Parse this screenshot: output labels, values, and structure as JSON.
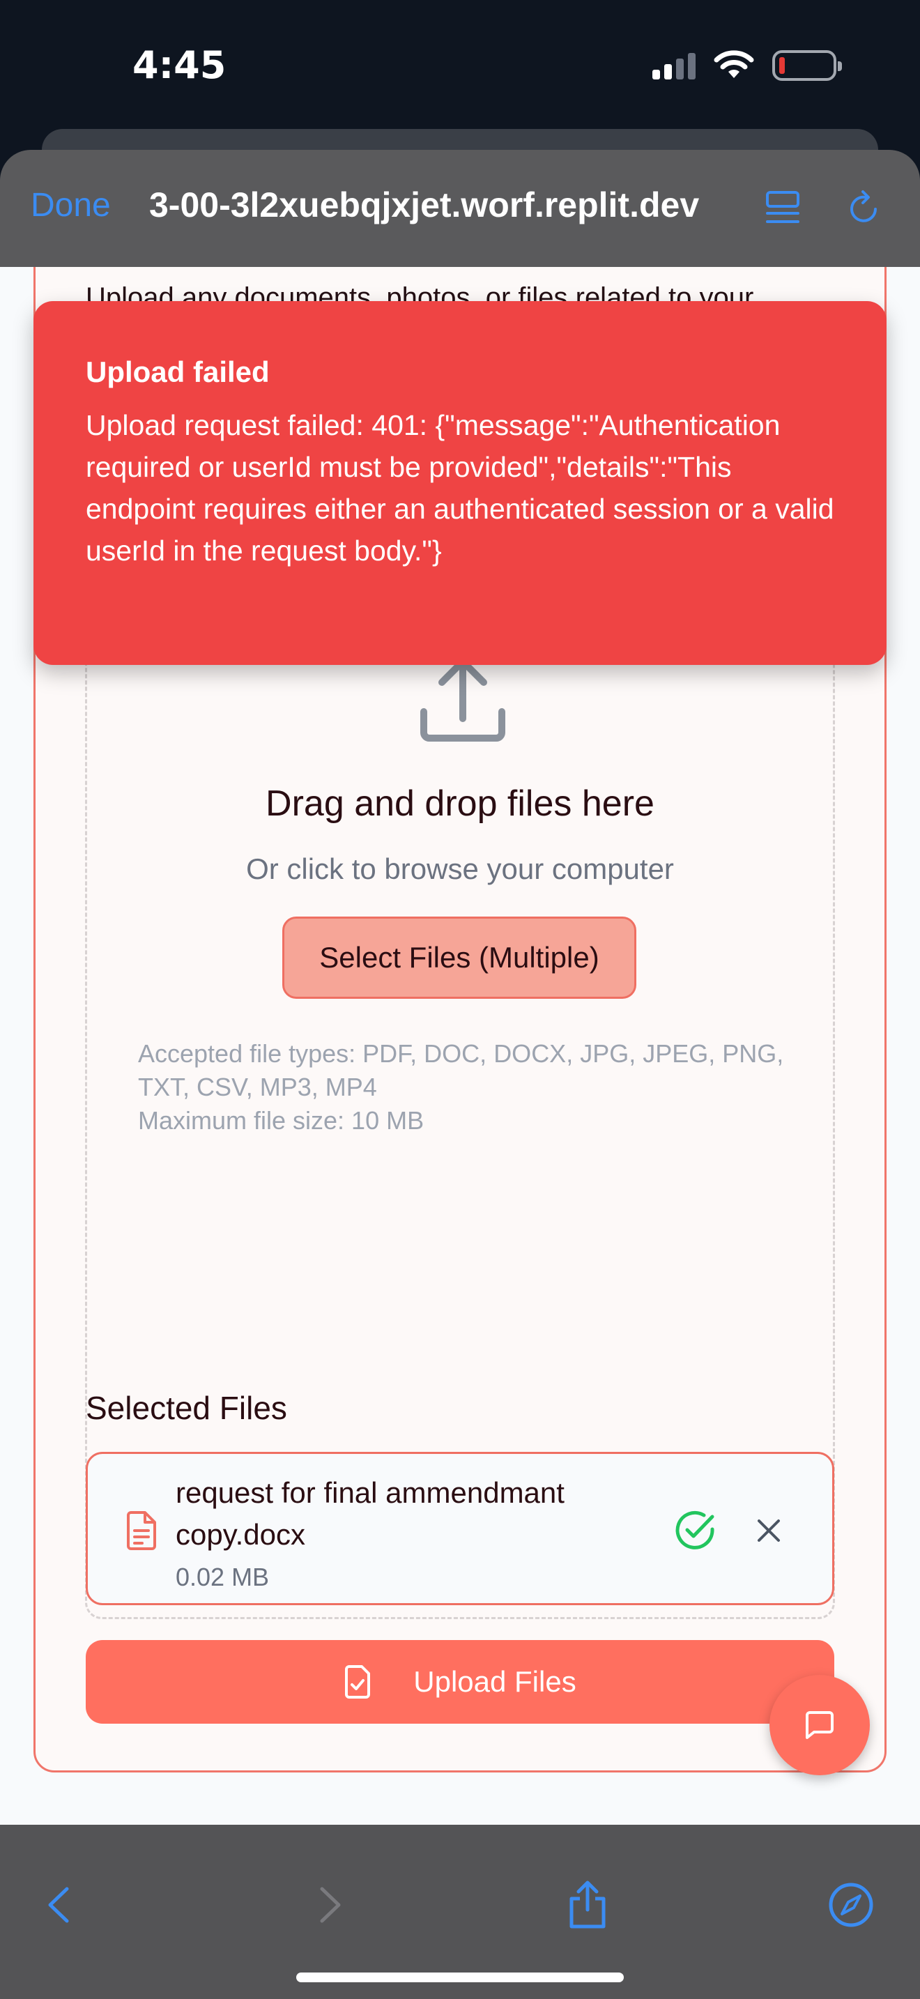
{
  "status_bar": {
    "time": "4:45"
  },
  "browser": {
    "done_label": "Done",
    "url": "3-00-3l2xuebqjxjet.worf.replit.dev"
  },
  "page": {
    "description": "Upload any documents, photos, or files related to your",
    "dropzone": {
      "title": "Drag and drop files here",
      "subtitle": "Or click to browse your computer",
      "select_button": "Select Files (Multiple)",
      "accepted_types": "Accepted file types: PDF, DOC, DOCX, JPG, JPEG, PNG, TXT, CSV, MP3, MP4",
      "max_size": "Maximum file size: 10 MB"
    },
    "selected_files_title": "Selected Files",
    "files": [
      {
        "name": "request for final ammendmant copy.docx",
        "size": "0.02 MB"
      }
    ],
    "upload_button": "Upload Files"
  },
  "toast": {
    "title": "Upload failed",
    "message": "Upload request failed: 401: {\"message\":\"Authentication required or userId must be provided\",\"details\":\"This endpoint requires either an authenticated session or a valid userId in the request body.\"}"
  },
  "colors": {
    "accent": "#ff6f5f",
    "toast": "#ef4444",
    "link_blue": "#3b8cf2",
    "success": "#22c55e"
  }
}
